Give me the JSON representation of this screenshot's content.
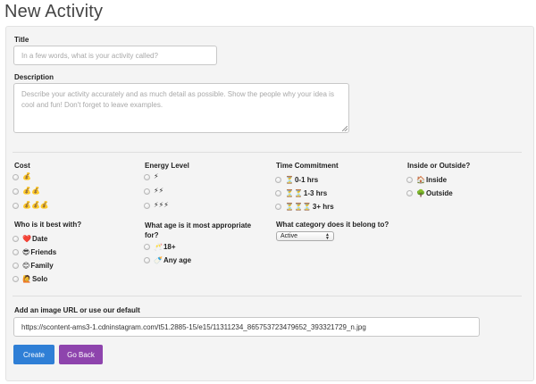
{
  "page": {
    "title": "New Activity"
  },
  "title_field": {
    "label": "Title",
    "placeholder": "In a few words, what is your activity called?"
  },
  "description_field": {
    "label": "Description",
    "placeholder": "Describe your activity accurately and as much detail as possible. Show the people why your idea is cool and fun! Don't forget to leave examples."
  },
  "cost": {
    "label": "Cost",
    "options": [
      "💰",
      "💰💰",
      "💰💰💰"
    ]
  },
  "energy": {
    "label": "Energy Level",
    "options": [
      "⚡",
      "⚡⚡",
      "⚡⚡⚡"
    ]
  },
  "time": {
    "label": "Time Commitment",
    "options": [
      {
        "icon": "⏳",
        "text": "0-1 hrs"
      },
      {
        "icon": "⏳⏳",
        "text": "1-3 hrs"
      },
      {
        "icon": "⏳⏳⏳",
        "text": "3+ hrs"
      }
    ]
  },
  "location": {
    "label": "Inside or Outside?",
    "options": [
      {
        "icon": "🏠",
        "text": "Inside"
      },
      {
        "icon": "🌳",
        "text": "Outside"
      }
    ]
  },
  "audience": {
    "label": "Who is it best with?",
    "options": [
      {
        "icon": "❤️",
        "text": "Date"
      },
      {
        "icon": "😎",
        "text": "Friends"
      },
      {
        "icon": "😊",
        "text": "Family"
      },
      {
        "icon": "🙋",
        "text": "Solo"
      }
    ]
  },
  "age": {
    "label": "What age is it most appropriate for?",
    "options": [
      {
        "icon": "🥂",
        "text": "18+"
      },
      {
        "icon": "🍼",
        "text": "Any age"
      }
    ]
  },
  "category": {
    "label": "What category does it belong to?",
    "selected": "Active"
  },
  "image": {
    "label": "Add an image URL or use our default",
    "value": "https://scontent-ams3-1.cdninstagram.com/t51.2885-15/e15/11311234_865753723479652_393321729_n.jpg"
  },
  "buttons": {
    "create": "Create",
    "back": "Go Back"
  },
  "colors": {
    "create": "#2f7fd6",
    "back": "#8e44ad",
    "panel": "#f4f4f4"
  }
}
